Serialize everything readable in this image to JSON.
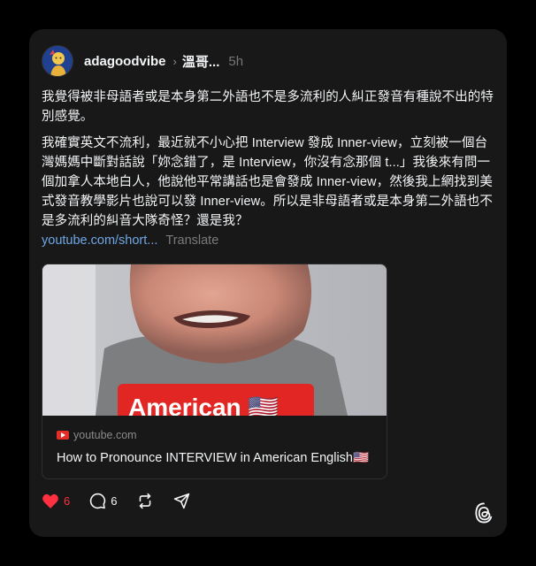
{
  "post": {
    "username": "adagoodvibe",
    "topic": "溫哥...",
    "time": "5h",
    "paragraph1": "我覺得被非母語者或是本身第二外語也不是多流利的人糾正發音有種說不出的特別感覺。",
    "paragraph2": "我確實英文不流利，最近就不小心把 Interview 發成 Inner-view，立刻被一個台灣媽媽中斷對話說「妳念錯了，是 Interview，你沒有念那個 t...」我後來有問一個加拿人本地白人，他說他平常講話也是會發成 Inner-view，然後我上網找到美式發音教學影片也說可以發 Inner-view。所以是非母語者或是本身第二外語也不是多流利的糾音大隊奇怪？還是我？",
    "link_text": "youtube.com/short...",
    "translate_label": "Translate"
  },
  "preview": {
    "thumbnail_caption": "American 🇺🇸",
    "domain": "youtube.com",
    "title": "How to Pronounce INTERVIEW in American English🇺🇸"
  },
  "actions": {
    "like_count": "6",
    "reply_count": "6"
  },
  "colors": {
    "background": "#000000",
    "card": "#181818",
    "link": "#6fa7e6",
    "like": "#ff3040"
  }
}
